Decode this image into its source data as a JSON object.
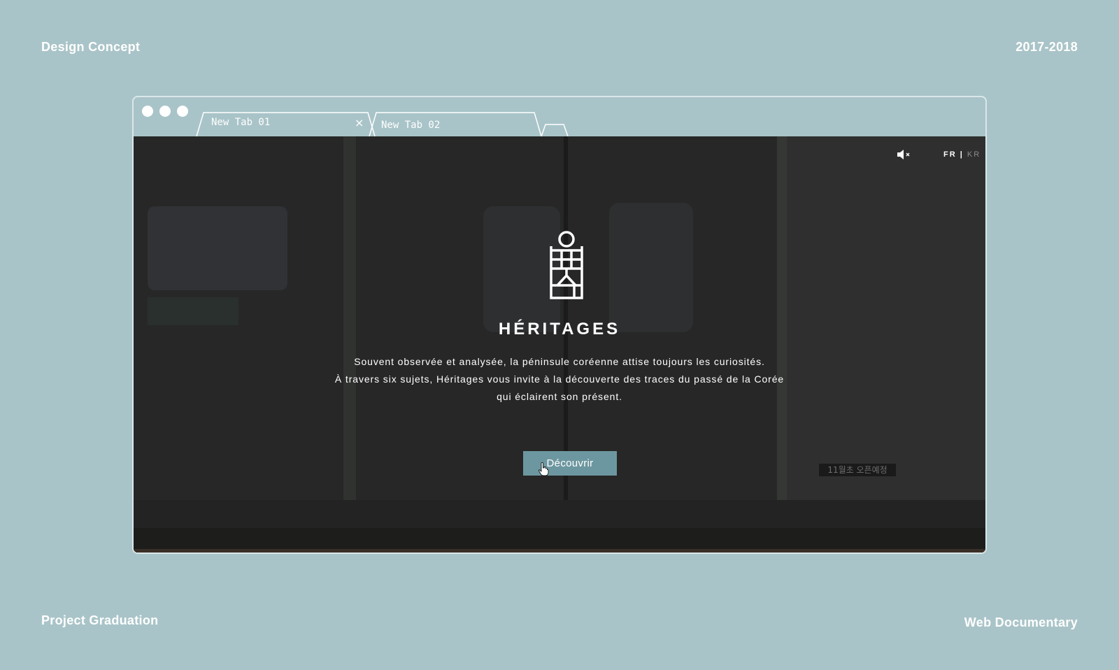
{
  "corners": {
    "top_left": "Design Concept",
    "top_right": "2017-2018",
    "bottom_left": "Project Graduation",
    "bottom_right": "Web Documentary"
  },
  "browser": {
    "tabs": [
      {
        "label": "New Tab 01",
        "close": "×"
      },
      {
        "label": "New Tab 02"
      }
    ]
  },
  "page": {
    "lang_active": "FR",
    "lang_separator": "|",
    "lang_inactive": "KR",
    "title": "HÉRITAGES",
    "description": [
      "Souvent observée et analysée, la péninsule coréenne attise toujours les curiosités.",
      "À travers six sujets, Héritages vous invite à la découverte des traces du passé de la Corée",
      "qui éclairent son présent."
    ],
    "cta_label": "Découvrir",
    "sign_text": "11월초 오픈예정"
  },
  "colors": {
    "background": "#a9c4c8",
    "viewport": "#262726",
    "button": "#6d97a0",
    "text": "#ffffff"
  },
  "icons": [
    "mute-icon",
    "heritage-logo-icon",
    "hand-cursor-icon"
  ]
}
